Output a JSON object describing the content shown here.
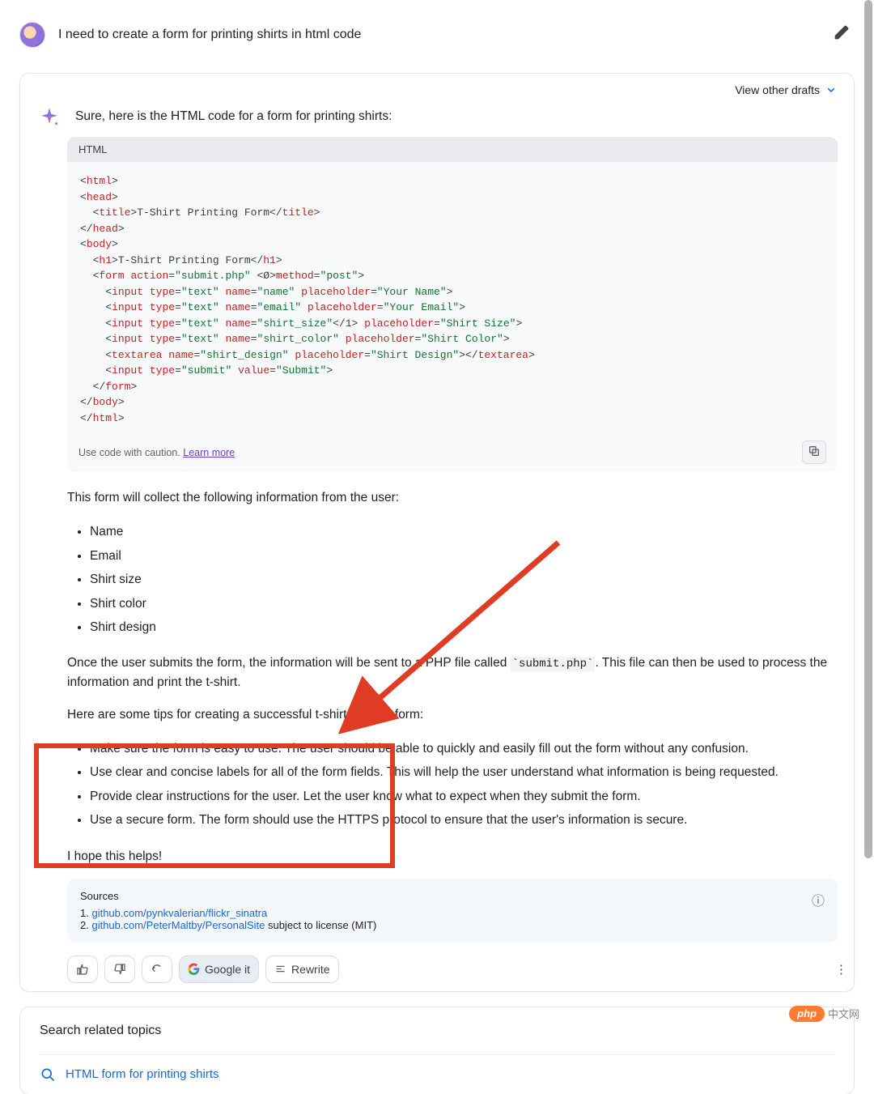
{
  "user_query": "I need to create a form for printing shirts in html code",
  "view_drafts": "View other drafts",
  "response_intro": "Sure, here is the HTML code for a form for printing shirts:",
  "code_lang": "HTML",
  "code_caution": "Use code with caution.",
  "code_learn": "Learn more",
  "follow_intro": "This form will collect the following information from the user:",
  "fields": [
    "Name",
    "Email",
    "Shirt size",
    "Shirt color",
    "Shirt design"
  ],
  "para2_a": "Once the user submits the form, the information will be sent to a PHP file called ",
  "para2_code": "`submit.php`",
  "para2_b": ". This file can then be used to process the information and print the t-shirt.",
  "tips_intro": "Here are some tips for creating a successful t-shirt printing form:",
  "tips": [
    "Make sure the form is easy to use. The user should be able to quickly and easily fill out the form without any confusion.",
    "Use clear and concise labels for all of the form fields. This will help the user understand what information is being requested.",
    "Provide clear instructions for the user. Let the user know what to expect when they submit the form.",
    "Use a secure form. The form should use the HTTPS protocol to ensure that the user's information is secure."
  ],
  "closing": "I hope this helps!",
  "sources_label": "Sources",
  "sources": [
    {
      "n": "1.",
      "url": "github.com/pynkvalerian/flickr_sinatra",
      "suffix": ""
    },
    {
      "n": "2.",
      "url": "github.com/PeterMaltby/PersonalSite",
      "suffix": " subject to license (MIT)"
    }
  ],
  "action_google": "Google it",
  "action_rewrite": "Rewrite",
  "search_header": "Search related topics",
  "suggestion": "HTML form for printing shirts",
  "watermark": {
    "pill": "php",
    "text": "中文网"
  }
}
